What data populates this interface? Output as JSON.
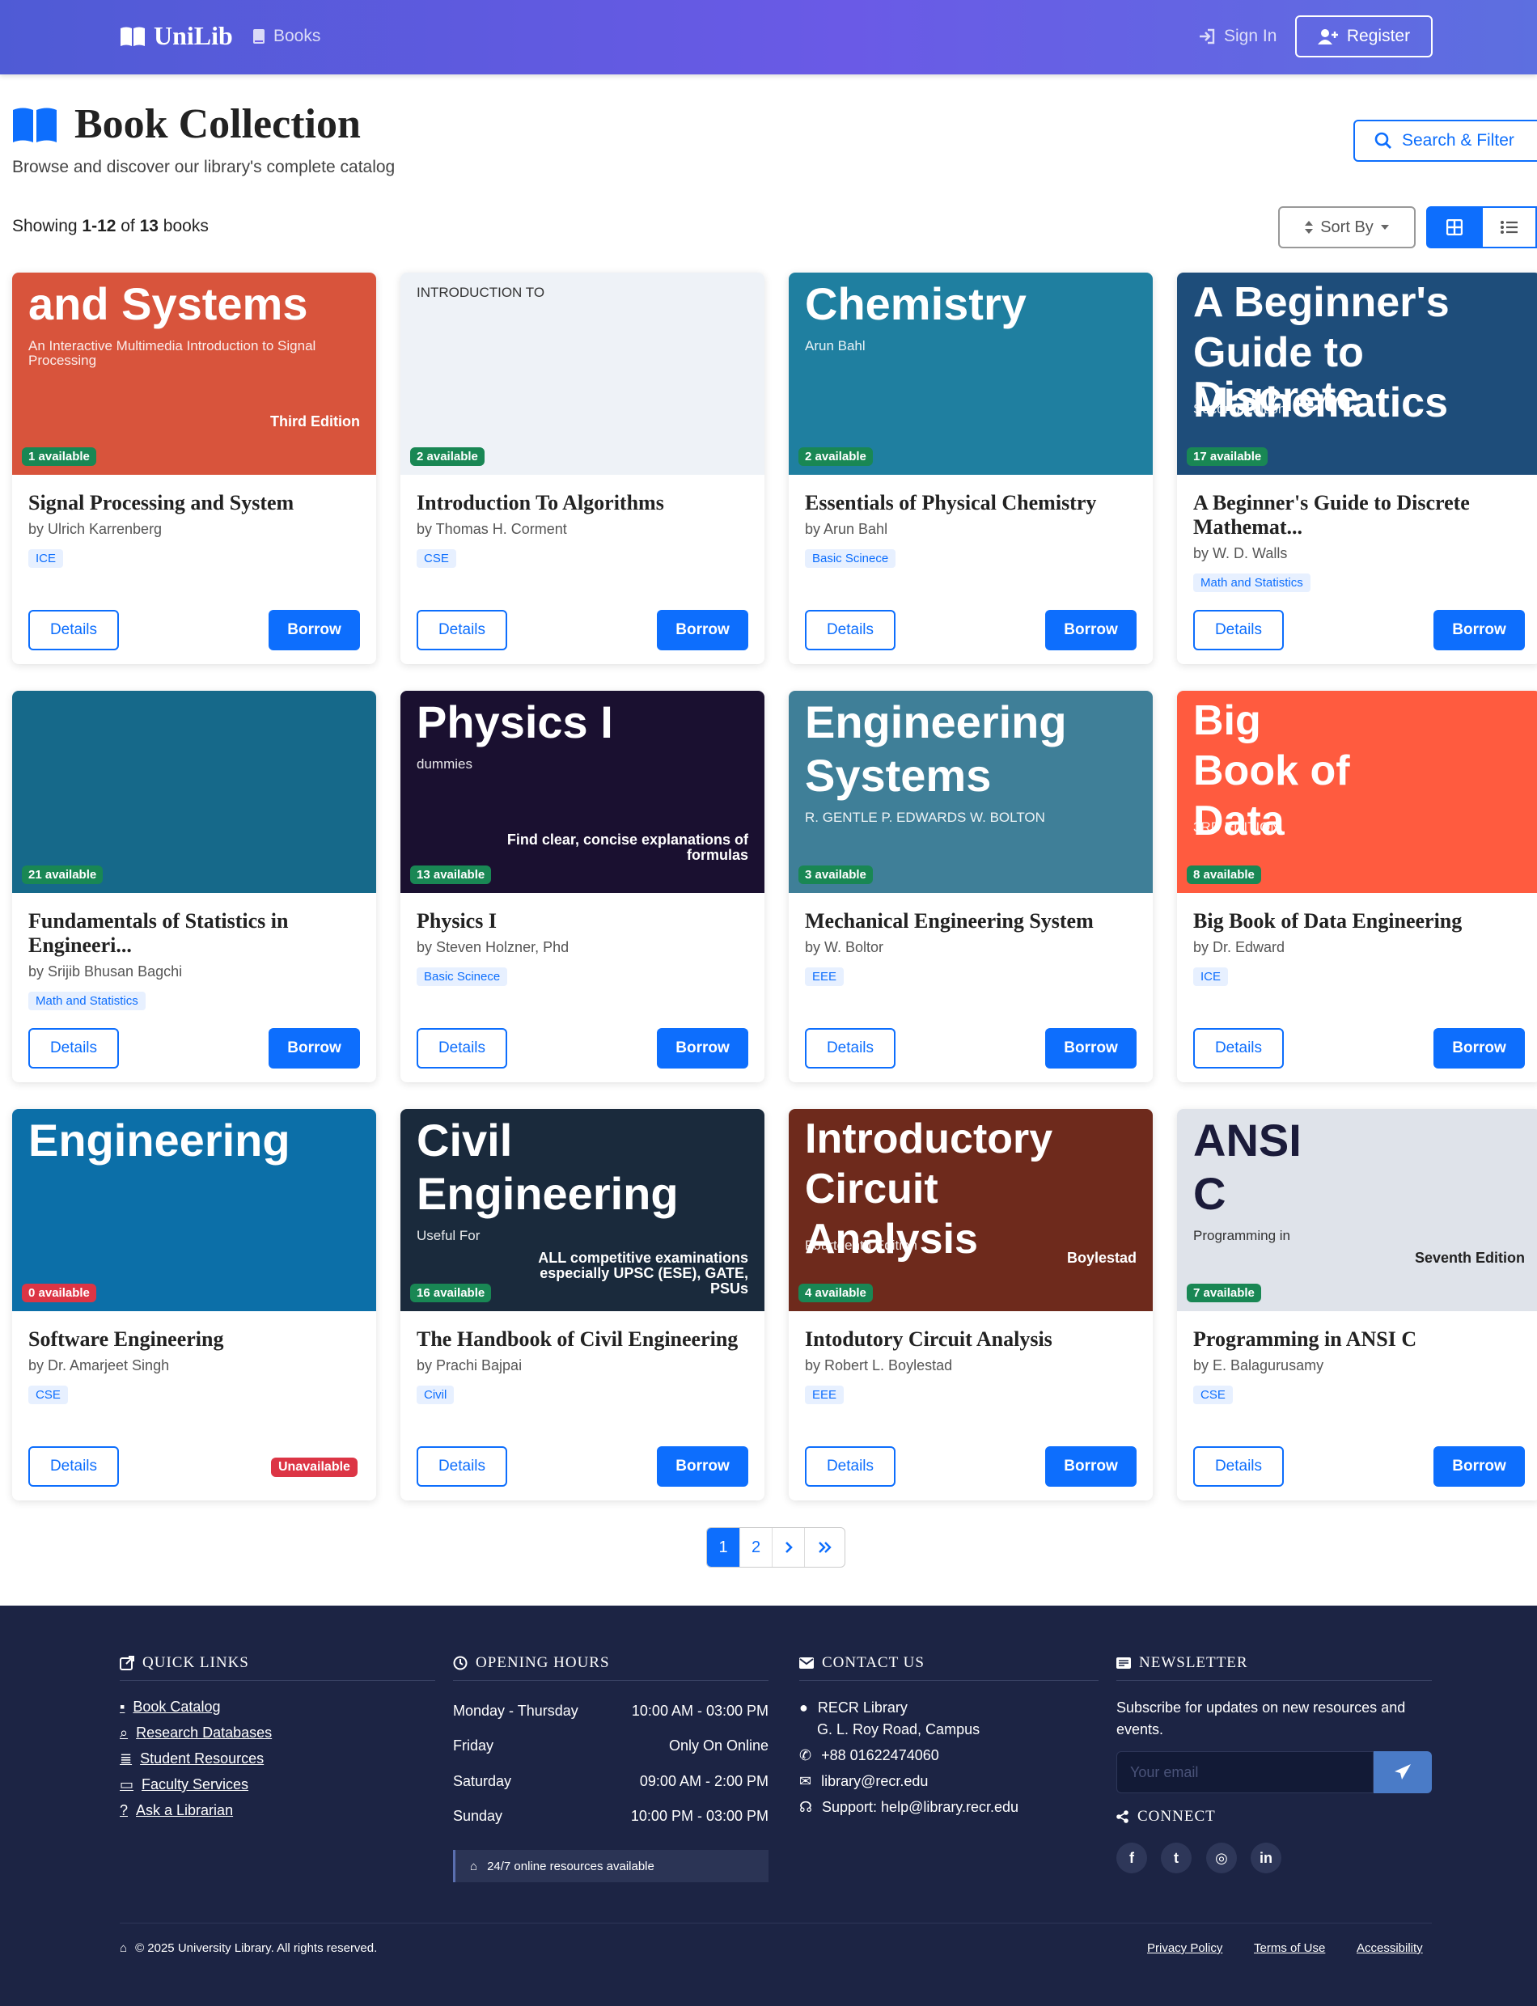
{
  "navbar": {
    "brand": "UniLib",
    "books_link": "Books",
    "sign_in": "Sign In",
    "register": "Register"
  },
  "header": {
    "title": "Book Collection",
    "subtitle": "Browse and discover our library's complete catalog",
    "search_filter": "Search & Filter"
  },
  "results": {
    "prefix": "Showing ",
    "range": "1-12",
    "middle": " of ",
    "total": "13",
    "suffix": " books",
    "sort_label": "Sort By"
  },
  "buttons": {
    "details": "Details",
    "borrow": "Borrow",
    "unavailable": "Unavailable"
  },
  "books": [
    {
      "title": "Signal Processing and System",
      "author": "by Ulrich Karrenberg",
      "dept": "ICE",
      "available": "1 available",
      "borrowable": true,
      "cover": {
        "bg": "#d8543c",
        "lines": [
          "and Systems"
        ],
        "sub": "An Interactive Multimedia Introduction to Signal Processing",
        "edition": "Third Edition"
      }
    },
    {
      "title": "Introduction To Algorithms",
      "author": "by Thomas H. Corment",
      "dept": "CSE",
      "available": "2 available",
      "borrowable": true,
      "cover": {
        "bg": "#eef2f7",
        "lines": [],
        "sub": "INTRODUCTION TO",
        "edition": ""
      }
    },
    {
      "title": "Essentials of Physical Chemistry",
      "author": "by Arun Bahl",
      "dept": "Basic Scinece",
      "available": "2 available",
      "borrowable": true,
      "cover": {
        "bg": "#1f7fa0",
        "lines": [
          "Chemistry"
        ],
        "sub": "Arun Bahl",
        "edition": ""
      }
    },
    {
      "title": "A Beginner's Guide to Discrete Mathemat...",
      "author": "by W. D. Walls",
      "dept": "Math and Statistics",
      "available": "17 available",
      "borrowable": true,
      "cover": {
        "bg": "#1e4d7a",
        "lines": [
          "A Beginner's",
          "Guide to Discrete",
          "Mathematics"
        ],
        "sub": "Second Edition",
        "edition": ""
      }
    },
    {
      "title": "Fundamentals of Statistics in Engineeri...",
      "author": "by Srijib Bhusan Bagchi",
      "dept": "Math and Statistics",
      "available": "21 available",
      "borrowable": true,
      "cover": {
        "bg": "#16698a",
        "lines": [],
        "sub": "",
        "edition": ""
      }
    },
    {
      "title": "Physics I",
      "author": "by Steven Holzner, Phd",
      "dept": "Basic Scinece",
      "available": "13 available",
      "borrowable": true,
      "cover": {
        "bg": "#1a1030",
        "lines": [
          "Physics I"
        ],
        "sub": "dummies",
        "edition": "Find clear, concise explanations of formulas"
      }
    },
    {
      "title": "Mechanical Engineering System",
      "author": "by W. Boltor",
      "dept": "EEE",
      "available": "3 available",
      "borrowable": true,
      "cover": {
        "bg": "#3f7f98",
        "lines": [
          "Engineering",
          "Systems"
        ],
        "sub": "R. GENTLE   P. EDWARDS   W. BOLTON",
        "edition": ""
      }
    },
    {
      "title": "Big Book of Data Engineering",
      "author": "by Dr. Edward",
      "dept": "ICE",
      "available": "8 available",
      "borrowable": true,
      "cover": {
        "bg": "#ff5b3f",
        "lines": [
          "Big",
          "Book of",
          "Data"
        ],
        "sub": "3RD EDITION",
        "edition": ""
      }
    },
    {
      "title": "Software Engineering",
      "author": "by Dr. Amarjeet Singh",
      "dept": "CSE",
      "available": "0 available",
      "borrowable": false,
      "cover": {
        "bg": "#0c6fa8",
        "lines": [
          "Engineering"
        ],
        "sub": "",
        "edition": ""
      }
    },
    {
      "title": "The Handbook of Civil Engineering",
      "author": "by Prachi Bajpai",
      "dept": "Civil",
      "available": "16 available",
      "borrowable": true,
      "cover": {
        "bg": "#1a2a3c",
        "lines": [
          "Civil",
          "Engineering"
        ],
        "sub": "Useful For",
        "edition": "ALL competitive examinations especially UPSC (ESE), GATE, PSUs"
      }
    },
    {
      "title": "Intodutory Circuit Analysis",
      "author": "by Robert L. Boylestad",
      "dept": "EEE",
      "available": "4 available",
      "borrowable": true,
      "cover": {
        "bg": "#6e2a1c",
        "lines": [
          "Introductory",
          "Circuit",
          "Analysis"
        ],
        "sub": "Fourteenth Edition",
        "edition": "Boylestad"
      }
    },
    {
      "title": "Programming in ANSI C",
      "author": "by E. Balagurusamy",
      "dept": "CSE",
      "available": "7 available",
      "borrowable": true,
      "cover": {
        "bg": "#dfe3ea",
        "lines": [
          "ANSI",
          "C"
        ],
        "sub": "Programming in",
        "edition": "Seventh Edition"
      }
    }
  ],
  "pagination": {
    "pages": [
      "1",
      "2"
    ],
    "next": "›",
    "last": "»",
    "current": "1"
  },
  "footer": {
    "quick_links": {
      "title": "QUICK LINKS",
      "items": [
        "Book Catalog",
        "Research Databases",
        "Student Resources",
        "Faculty Services",
        "Ask a Librarian"
      ]
    },
    "hours": {
      "title": "OPENING HOURS",
      "rows": [
        {
          "day": "Monday - Thursday",
          "time": "10:00 AM - 03:00 PM"
        },
        {
          "day": "Friday",
          "time": "Only On Online"
        },
        {
          "day": "Saturday",
          "time": "09:00 AM - 2:00 PM"
        },
        {
          "day": "Sunday",
          "time": "10:00 PM - 03:00 PM"
        }
      ],
      "note": "24/7 online resources available"
    },
    "contact": {
      "title": "CONTACT US",
      "address1": "RECR Library",
      "address2": "G. L. Roy Road, Campus",
      "phone": "+88 01622474060",
      "email": "library@recr.edu",
      "support": "Support: help@library.recr.edu"
    },
    "newsletter": {
      "title": "NEWSLETTER",
      "text1": "Subscribe for updates on new resources and",
      "text2": "events.",
      "placeholder": "Your email",
      "connect": "CONNECT"
    },
    "copyright": "© 2025 University Library. All rights reserved.",
    "legal": [
      "Privacy Policy",
      "Terms of Use",
      "Accessibility"
    ]
  },
  "colors": {
    "primary": "#0d6efd",
    "success": "#198754",
    "danger": "#dc3545",
    "footer_bg": "#1c2444"
  }
}
